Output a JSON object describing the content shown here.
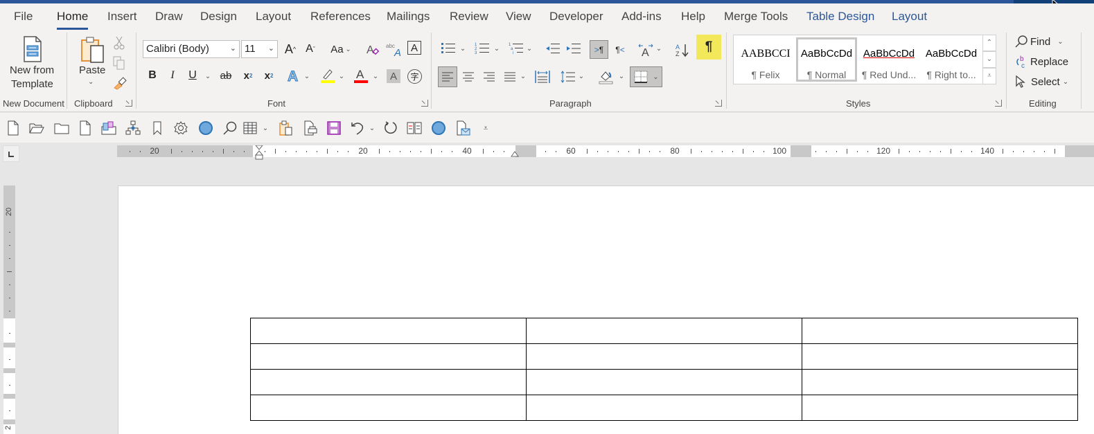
{
  "tabs": [
    {
      "label": "File"
    },
    {
      "label": "Home",
      "active": true
    },
    {
      "label": "Insert"
    },
    {
      "label": "Draw"
    },
    {
      "label": "Design"
    },
    {
      "label": "Layout"
    },
    {
      "label": "References"
    },
    {
      "label": "Mailings"
    },
    {
      "label": "Review"
    },
    {
      "label": "View"
    },
    {
      "label": "Developer"
    },
    {
      "label": "Add-ins"
    },
    {
      "label": "Help"
    },
    {
      "label": "Merge Tools"
    },
    {
      "label": "Table Design",
      "contextual": true
    },
    {
      "label": "Layout",
      "contextual": true
    }
  ],
  "ribbon": {
    "new_document": {
      "button_label_1": "New from",
      "button_label_2": "Template",
      "group_label": "New Document"
    },
    "clipboard": {
      "paste_label": "Paste",
      "group_label": "Clipboard",
      "icons": [
        "cut-icon",
        "copy-icon",
        "format-painter-icon"
      ]
    },
    "font": {
      "font_name": "Calibri (Body)",
      "font_size": "11",
      "group_label": "Font",
      "bold": "B",
      "italic": "I",
      "underline": "U",
      "strike": "ab",
      "subscript": "x",
      "superscript": "x",
      "change_case": "Aa",
      "highlight_color": "#ffff00",
      "font_color": "#ff0000"
    },
    "paragraph": {
      "group_label": "Paragraph",
      "show_marks_symbol": "¶",
      "show_marks_active_color": "#f3e85a"
    },
    "styles": {
      "group_label": "Styles",
      "items": [
        {
          "sample": "AABBCCI",
          "name": "¶ Felix"
        },
        {
          "sample": "AaBbCcDd",
          "name": "¶ Normal",
          "selected": true
        },
        {
          "sample": "AaBbCcDd",
          "name": "¶ Red Und..."
        },
        {
          "sample": "AaBbCcDd",
          "name": "¶ Right to..."
        }
      ]
    },
    "editing": {
      "group_label": "Editing",
      "find": "Find",
      "replace": "Replace",
      "select": "Select"
    }
  },
  "qat": {
    "icons": [
      "new-doc-icon",
      "open-folder-icon",
      "folder-icon",
      "blank-page-icon",
      "3d-models-icon",
      "org-chart-icon",
      "bookmark-icon",
      "settings-gear-icon",
      "blue-circle-icon",
      "search-icon",
      "table-icon",
      "paste-special-icon",
      "print-preview-icon",
      "save-icon",
      "undo-icon",
      "redo-icon",
      "read-mode-icon",
      "blue-circle-icon-2",
      "email-doc-icon",
      "customize-qat-icon"
    ]
  },
  "ruler": {
    "horizontal_labels": [
      "20",
      "20",
      "40",
      "60",
      "80",
      "100",
      "120",
      "140"
    ],
    "vertical_labels": [
      "20",
      "2"
    ]
  },
  "document": {
    "table": {
      "rows": 4,
      "cols": 3,
      "cells": [
        [
          "",
          "",
          ""
        ],
        [
          "",
          "",
          ""
        ],
        [
          "",
          "",
          ""
        ],
        [
          "",
          "",
          ""
        ]
      ]
    }
  },
  "colors": {
    "accent": "#2b579a",
    "ribbon_bg": "#f3f2f1",
    "workspace_bg": "#e6e6e6"
  }
}
